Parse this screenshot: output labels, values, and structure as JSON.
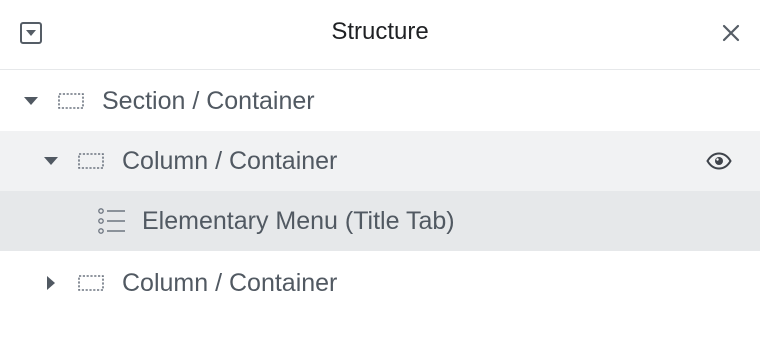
{
  "header": {
    "title": "Structure",
    "toggle_icon": "collapse-panel-icon",
    "close_icon": "close-icon"
  },
  "tree": {
    "items": [
      {
        "label": "Section / Container",
        "icon": "container-icon",
        "expanded": true
      },
      {
        "label": "Column / Container",
        "icon": "container-icon",
        "expanded": true,
        "state": "hover",
        "visibility_icon": "eye-icon"
      },
      {
        "label": "Elementary Menu (Title Tab)",
        "icon": "list-icon",
        "state": "selected"
      },
      {
        "label": "Column / Container",
        "icon": "container-icon",
        "expanded": false
      }
    ]
  },
  "colors": {
    "hover_row": "#f1f2f3",
    "selected_row": "#e6e8ea",
    "text": "#515962",
    "title": "#1f2124"
  }
}
